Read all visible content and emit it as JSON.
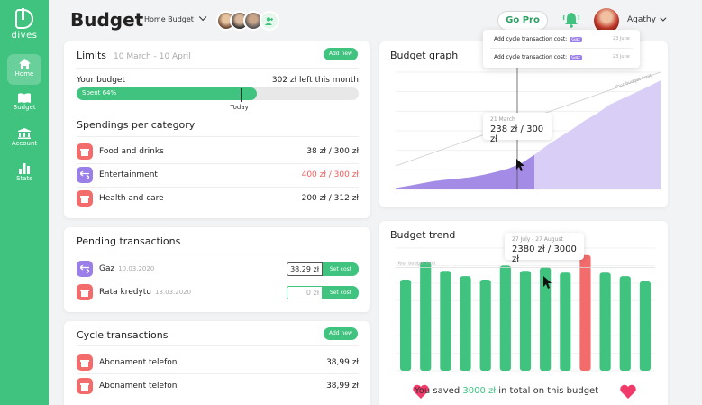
{
  "app": {
    "logo_text": "dives",
    "page_title": "Budget",
    "project": "Home Budget",
    "go_pro": "Go Pro",
    "user": "Agathy"
  },
  "sidebar": {
    "items": [
      {
        "label": "Home"
      },
      {
        "label": "Budget"
      },
      {
        "label": "Account"
      },
      {
        "label": "Stats"
      }
    ]
  },
  "limits": {
    "title": "Limits",
    "period": "10 March - 10 April",
    "add_new": "Add new",
    "your_budget": "Your budget",
    "left": "302 zł left this month",
    "spent_label": "Spent 64%",
    "spent_fraction": 0.64,
    "today": "Today",
    "today_fraction": 0.58,
    "spendings_title": "Spendings per category",
    "categories": [
      {
        "name": "Food and drinks",
        "value": "38 zł / 300 zł",
        "over": false,
        "icon": "gift-icon"
      },
      {
        "name": "Entertainment",
        "value": "400 zł / 300 zł",
        "over": true,
        "icon": "arrows-icon"
      },
      {
        "name": "Health and care",
        "value": "200 zł / 312 zł",
        "over": false,
        "icon": "gift-icon"
      }
    ]
  },
  "pending": {
    "title": "Pending transactions",
    "set_cost": "Set cost",
    "items": [
      {
        "name": "Gaz",
        "date": "10.03.2020",
        "amount": "38,29 zł",
        "empty": false
      },
      {
        "name": "Rata kredytu",
        "date": "13.03.2020",
        "amount": "0 zł",
        "empty": true
      }
    ]
  },
  "cycle": {
    "title": "Cycle transactions",
    "add_new": "Add new",
    "items": [
      {
        "name": "Abonament telefon",
        "value": "38,99 zł"
      },
      {
        "name": "Abonament telefon",
        "value": "38,99 zł"
      }
    ]
  },
  "notifications": [
    {
      "text": "Add cycle transaction cost:",
      "tag": "Gaz",
      "date": "23 June"
    },
    {
      "text": "Add cycle transaction cost:",
      "tag": "Gaz",
      "date": "23 June"
    }
  ],
  "budget_graph": {
    "title": "Budget graph",
    "tooltip_date": "21 March",
    "tooltip_value": "238 zł / 300 zł",
    "limit_label": "Your budget limit"
  },
  "budget_trend": {
    "title": "Budget trend",
    "tooltip_date": "27 July - 27 August",
    "tooltip_value": "2380 zł / 3000 zł",
    "limit_label": "Your budget limit",
    "saved_prefix": "You saved",
    "saved_amount": "3000 zł",
    "saved_suffix": "in total on this budget"
  },
  "chart_data": [
    {
      "type": "area",
      "title": "Budget graph",
      "series": [
        {
          "values": [
            5,
            12,
            20,
            28,
            33,
            37,
            42,
            50,
            60,
            72,
            90,
            118,
            150,
            178,
            205,
            235,
            260,
            290,
            310,
            330,
            350,
            372
          ]
        }
      ],
      "ylim": [
        0,
        400
      ],
      "limit": [
        80,
        400
      ]
    },
    {
      "type": "bar",
      "title": "Budget trend",
      "series": [
        {
          "values": [
            2600,
            3100,
            2850,
            2700,
            2600,
            3000,
            2850,
            2950,
            2800,
            3300,
            2800,
            2700,
            2550
          ]
        }
      ],
      "highlight_index": 9,
      "ylim": [
        0,
        3500
      ],
      "limit": 2950
    }
  ],
  "colors": {
    "primary": "#3fc37f",
    "danger": "#f36b6b",
    "purple": "#9a7fe8"
  }
}
